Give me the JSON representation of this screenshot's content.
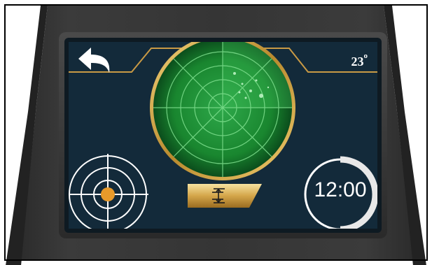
{
  "screen": {
    "temperature": "23",
    "temperature_unit": "o",
    "clock": "12:00"
  },
  "icons": {
    "back": "back-arrow-icon",
    "target": "target-crosshair-icon",
    "adjust": "vertical-adjust-icon",
    "radar": "radar-display"
  },
  "colors": {
    "screen_bg": "#132a3a",
    "accent_gold": "#d4a64a",
    "radar_green": "#1fa83a",
    "target_dot": "#e89a2a"
  }
}
